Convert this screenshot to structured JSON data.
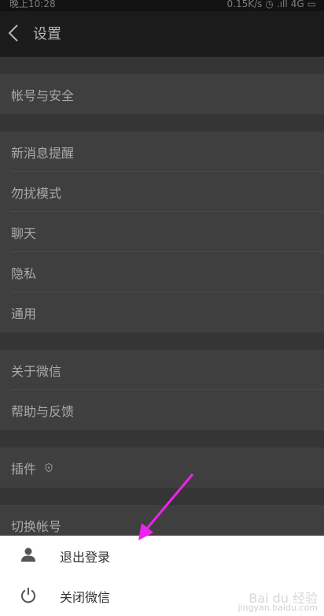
{
  "status_bar": {
    "time": "晚上10:28",
    "speed": "0.15K/s",
    "network": "4G"
  },
  "header": {
    "title": "设置"
  },
  "settings": {
    "account_security": "帐号与安全",
    "new_message_alert": "新消息提醒",
    "do_not_disturb": "勿扰模式",
    "chat": "聊天",
    "privacy": "隐私",
    "general": "通用",
    "about": "关于微信",
    "help_feedback": "帮助与反馈",
    "plugins": "插件",
    "switch_account": "切换帐号"
  },
  "sheet": {
    "logout": "退出登录",
    "close_wechat": "关闭微信"
  },
  "watermark": {
    "brand": "Bai du 经验",
    "url": "jingyan.baidu.com"
  },
  "colors": {
    "annotation_arrow": "#ee22ee"
  }
}
